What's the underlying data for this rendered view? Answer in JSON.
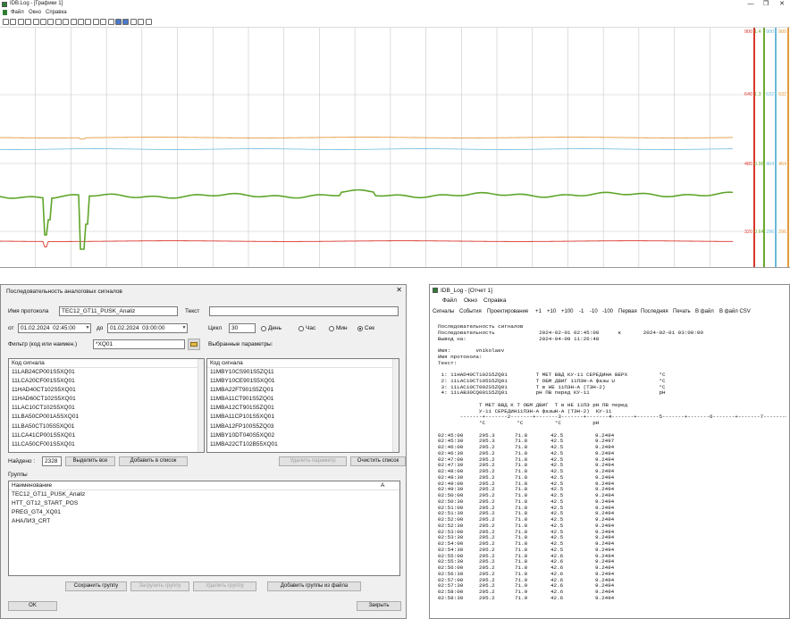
{
  "trend": {
    "title": "IDB.Log - [Графики 1]",
    "menu": [
      "Файл",
      "Окно",
      "Справка"
    ],
    "window_controls": [
      "—",
      "❐",
      "✕"
    ],
    "scale_colors": [
      "#d9362b",
      "#6aa82c",
      "#6bb8d9",
      "#e09a3c"
    ],
    "scale_rows": [
      [
        "900",
        "1.4",
        "900",
        "900"
      ],
      [
        "640",
        "1.3",
        "632",
        "632"
      ],
      [
        "480",
        "0.96",
        "464",
        "464"
      ],
      [
        "320",
        "0.64",
        "296",
        "296"
      ]
    ]
  },
  "dialog": {
    "title": "Последовательность аналоговых сигналов",
    "close": "✕",
    "protocol_label": "Имя протокола",
    "protocol_value": "TEC12_GT11_PUSK_Analiz",
    "text_label": "Текст",
    "text_value": "",
    "from_label": "от",
    "from_date": "01.02.2024",
    "from_time": "02:45:00",
    "to_label": "до",
    "to_date": "01.02.2024",
    "to_time": "03:00:00",
    "cycle_label": "Цикл",
    "cycle_value": "30",
    "radio_options": [
      "День",
      "Час",
      "Мин",
      "Сек"
    ],
    "radio_selected": "Сек",
    "filter_label": "Фильтр (код или наимен.)",
    "filter_value": "*XQ01",
    "selected_params_label": "Выбранные параметры:",
    "left_list_header": "Код сигнала",
    "left_list": [
      "11LAB24CP001S5XQ01",
      "11LCA20CF001S5XQ01",
      "11HAD40CT102S5XQ01",
      "11HAD60CT102S5XQ01",
      "11LAC10CT102S5XQ01",
      "11LBA50CP001A5SXQ01",
      "11LBA50CT105S5XQ01",
      "11LCA41CP001S5XQ01",
      "11LCA50CF001S5XQ01"
    ],
    "right_list_header": "Код сигнала",
    "right_list": [
      "11MBY10CS901S5ZQ11",
      "11MBY10CE901S5XQ01",
      "11MBA22FT901S5ZQ01",
      "11MBA11CT901S5ZQ01",
      "11MBA12CT901S5ZQ01",
      "11MBA11CP101S5XQ01",
      "11MBA12FP100S5ZQ03",
      "11MBY10DT040S5XQ02",
      "11MBA22CT102B55XQ01"
    ],
    "found_label": "Найдено :",
    "found_value": "2328",
    "btn_select_all": "Выделить все",
    "btn_add_to_list": "Добавить в список",
    "btn_remove_param": "Удалить параметр",
    "btn_clear_list": "Очистить список",
    "groups_label": "Группы",
    "groups_header": "Наименование",
    "groups_header_right": "А",
    "groups": [
      "TEC12_GT11_PUSK_Analiz",
      "HTT_GT12_START_POS",
      "PREG_GT4_XQ01",
      "АНАЛИЗ_CRT"
    ],
    "btn_save_group": "Сохранить группу",
    "btn_load_group": "Загрузить группу",
    "btn_delete_group": "Удалить группу",
    "btn_add_groups_file": "Добавить группы из файла",
    "btn_ok": "OK",
    "btn_close": "Закрыть"
  },
  "report": {
    "title": "IDB_Log - [Отчет 1]",
    "menu": [
      "Файл",
      "Окно",
      "Справка"
    ],
    "toolbar": [
      "Сигналы",
      "События",
      "Проектирование",
      "+1",
      "+10",
      "+100",
      "-1",
      "-10",
      "-100",
      "Первая",
      "Последняя",
      "Печать",
      "В файл",
      "В файл CSV"
    ],
    "header_lines": [
      "Последовательность сигналов",
      "Последовательность              2024-02-01 02:45:00      к       2024-02-01 03:00:00",
      "Вывод на:                       2024-04-09 11:26:48",
      "",
      "Имя:        vnikolaev",
      "Имя протокола:",
      "Текст:",
      "",
      " 1: 11HAD40CT102S5ZQ01         T МЕТ ВВД КУ-11 СЕРЕДИНА ВЕРХ          °C",
      " 2: 11LAC10CT105S5ZQ01         T ОБМ ДВИГ 11ПЭН-А фазы U              °C",
      " 3: 11LAC10CT002S5ZQ01         T в НЕ 11ПЭН-А (ТЭН-2)                 °C",
      " 4: 11LAB30CQ001S5ZQ01         pH ПВ перед КУ-11                      pH",
      "",
      "             T МЕТ ВВД К Т ОБМ ДВИГ  T в НЕ 11ПЭ pH ПВ перед",
      "             У-11 СЕРЕДИН11ПЭН-А фазыН-А (ТЭН-2)  КУ-11",
      "       -------+-------2-------+-------3-------+-------4-------+-------5-------+-------6-------+-------7-------+--",
      "             °C          °C          °C          pH",
      ""
    ],
    "rows": [
      [
        "02:45:00",
        "295.3",
        "71.8",
        "42.5",
        "9.2494"
      ],
      [
        "02:45:30",
        "295.3",
        "71.8",
        "42.5",
        "9.2497"
      ],
      [
        "02:46:00",
        "295.2",
        "71.8",
        "42.5",
        "9.2494"
      ],
      [
        "02:46:30",
        "295.2",
        "71.8",
        "42.5",
        "9.2494"
      ],
      [
        "02:47:00",
        "295.2",
        "71.8",
        "42.5",
        "9.2494"
      ],
      [
        "02:47:30",
        "295.2",
        "71.8",
        "42.5",
        "9.2494"
      ],
      [
        "02:48:00",
        "295.2",
        "71.8",
        "42.5",
        "9.2494"
      ],
      [
        "02:48:30",
        "295.2",
        "71.8",
        "42.5",
        "9.2494"
      ],
      [
        "02:49:00",
        "295.2",
        "71.8",
        "42.5",
        "9.2494"
      ],
      [
        "02:49:30",
        "295.2",
        "71.8",
        "42.5",
        "9.2494"
      ],
      [
        "02:50:00",
        "295.2",
        "71.8",
        "42.5",
        "9.2494"
      ],
      [
        "02:50:30",
        "295.2",
        "71.8",
        "42.5",
        "9.2494"
      ],
      [
        "02:51:00",
        "295.2",
        "71.8",
        "42.5",
        "9.2494"
      ],
      [
        "02:51:30",
        "295.2",
        "71.8",
        "42.5",
        "9.2494"
      ],
      [
        "02:52:00",
        "295.2",
        "71.8",
        "42.5",
        "9.2494"
      ],
      [
        "02:52:30",
        "295.2",
        "71.8",
        "42.5",
        "9.2494"
      ],
      [
        "02:53:00",
        "295.2",
        "71.8",
        "42.5",
        "9.2494"
      ],
      [
        "02:53:30",
        "295.2",
        "71.8",
        "42.5",
        "9.2494"
      ],
      [
        "02:54:00",
        "295.2",
        "71.8",
        "42.5",
        "9.2494"
      ],
      [
        "02:54:30",
        "295.2",
        "71.8",
        "42.5",
        "9.2494"
      ],
      [
        "02:55:00",
        "295.2",
        "71.8",
        "42.6",
        "9.2494"
      ],
      [
        "02:55:30",
        "295.2",
        "71.8",
        "42.6",
        "9.2494"
      ],
      [
        "02:56:00",
        "295.2",
        "71.8",
        "42.6",
        "9.2494"
      ],
      [
        "02:56:30",
        "295.2",
        "71.8",
        "42.6",
        "9.2494"
      ],
      [
        "02:57:00",
        "295.2",
        "71.9",
        "42.6",
        "9.2494"
      ],
      [
        "02:57:30",
        "295.2",
        "71.9",
        "42.6",
        "9.2494"
      ],
      [
        "02:58:00",
        "295.2",
        "71.9",
        "42.6",
        "9.2494"
      ],
      [
        "02:58:30",
        "295.2",
        "71.9",
        "42.6",
        "9.2494"
      ]
    ]
  }
}
